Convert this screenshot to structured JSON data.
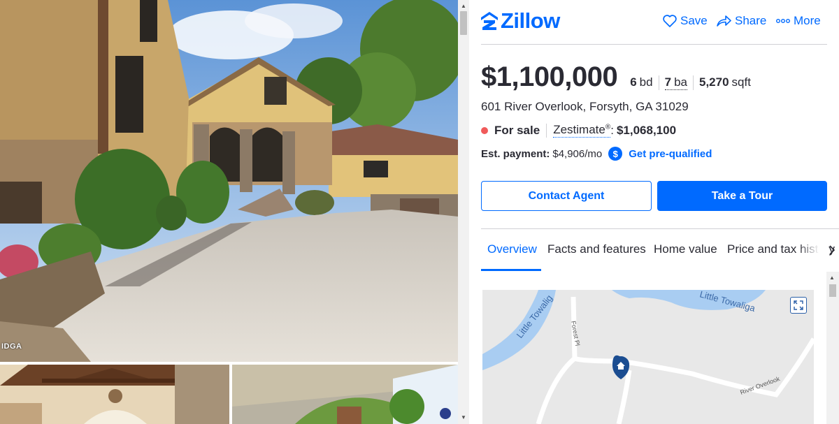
{
  "brand": {
    "name": "Zillow",
    "color": "#006aff"
  },
  "header": {
    "actions": [
      {
        "label": "Save",
        "icon": "heart-icon"
      },
      {
        "label": "Share",
        "icon": "share-icon"
      },
      {
        "label": "More",
        "icon": "more-dots-icon"
      }
    ]
  },
  "gallery": {
    "watermark": "IDGA"
  },
  "listing": {
    "price": "$1,100,000",
    "beds_value": "6",
    "beds_unit": "bd",
    "baths_value": "7",
    "baths_unit": "ba",
    "sqft_value": "5,270",
    "sqft_unit": "sqft",
    "address": "601 River Overlook, Forsyth, GA 31029",
    "status": "For sale",
    "status_color": "#f05a5a",
    "zestimate_label": "Zestimate",
    "zestimate_reg": "®",
    "zestimate_value": "$1,068,100",
    "payment_label": "Est. payment:",
    "payment_value": "$4,906/mo",
    "prequal_icon": "$",
    "prequal_link": "Get pre-qualified"
  },
  "buttons": {
    "contact": "Contact Agent",
    "tour": "Take a Tour"
  },
  "tabs": [
    {
      "label": "Overview",
      "active": true
    },
    {
      "label": "Facts and features",
      "active": false
    },
    {
      "label": "Home value",
      "active": false
    },
    {
      "label": "Price and tax history",
      "active": false
    }
  ],
  "map": {
    "labels": {
      "river_left": "Little Towalig",
      "river_right": "Little Towaliga",
      "street_forest": "Forest Pl",
      "street_river": "River Overlook"
    }
  }
}
